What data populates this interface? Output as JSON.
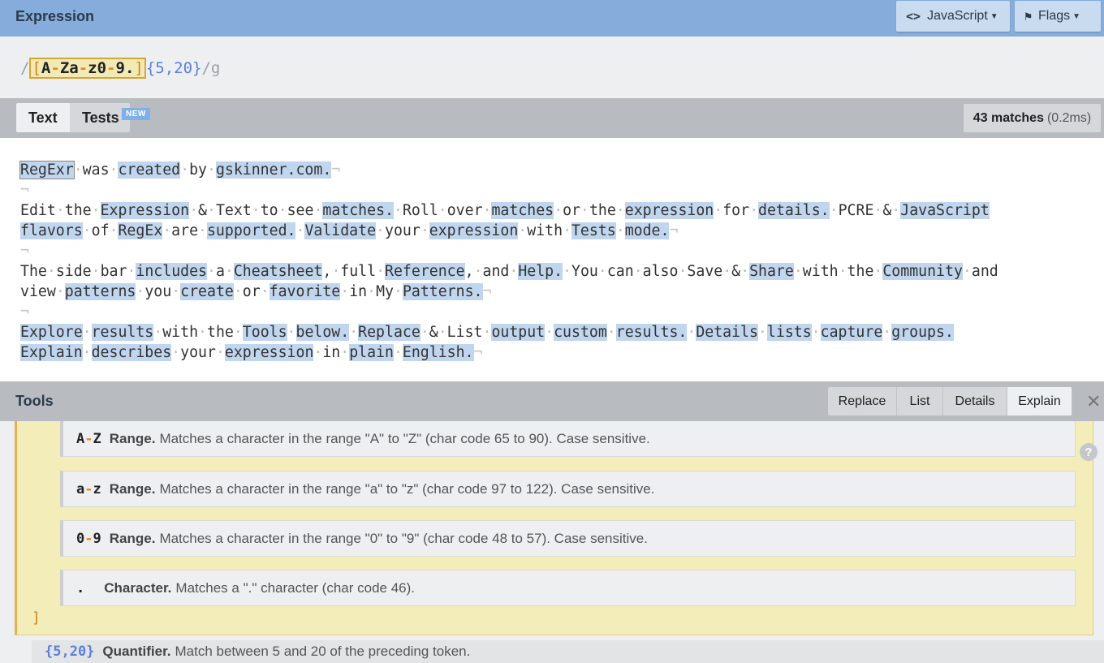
{
  "header": {
    "title": "Expression",
    "flavor_label": "JavaScript",
    "flags_label": "Flags"
  },
  "expression": {
    "open_slash": "/",
    "set_open": "[",
    "r1_from": "A",
    "r1_dash": "-",
    "r1_to": "Za",
    "r2_dash": "-",
    "r2_to": "z0",
    "r3_dash": "-",
    "r3_to": "9.",
    "set_close": "]",
    "quantifier": "{5,20}",
    "close_and_flags": "/g"
  },
  "text_bar": {
    "tab_text": "Text",
    "tab_tests": "Tests",
    "new_badge": "NEW",
    "match_count": "43 matches",
    "match_time": "(0.2ms)"
  },
  "tools": {
    "title": "Tools",
    "replace": "Replace",
    "list": "List",
    "details": "Details",
    "explain": "Explain",
    "close": "✕"
  },
  "explain": {
    "items": [
      {
        "tok_a": "A",
        "tok_dash": "-",
        "tok_b": "Z",
        "title": "Range.",
        "desc": "Matches a character in the range \"A\" to \"Z\" (char code 65 to 90). Case sensitive."
      },
      {
        "tok_a": "a",
        "tok_dash": "-",
        "tok_b": "z",
        "title": "Range.",
        "desc": "Matches a character in the range \"a\" to \"z\" (char code 97 to 122). Case sensitive."
      },
      {
        "tok_a": "0",
        "tok_dash": "-",
        "tok_b": "9",
        "title": "Range.",
        "desc": "Matches a character in the range \"0\" to \"9\" (char code 48 to 57). Case sensitive."
      },
      {
        "tok_a": ".",
        "tok_dash": "",
        "tok_b": "",
        "title": "Character.",
        "desc": "Matches a \".\" character (char code 46)."
      }
    ],
    "close_bracket": "]",
    "help": "?",
    "quantifier": {
      "tok": "{5,20}",
      "title": "Quantifier.",
      "desc": "Match between 5 and 20 of the preceding token."
    }
  },
  "text_lines": [
    "RegExr was created by gskinner.com.",
    "",
    "Edit the Expression & Text to see matches. Roll over matches or the expression for details. PCRE & JavaScript",
    "flavors of RegEx are supported. Validate your expression with Tests mode.",
    "",
    "The side bar includes a Cheatsheet, full Reference, and Help. You can also Save & Share with the Community and",
    "view patterns you create or favorite in My Patterns.",
    "",
    "Explore results with the Tools below. Replace & List output custom results. Details lists capture groups.",
    "Explain describes your expression in plain English."
  ],
  "text_eol": [
    true,
    true,
    false,
    true,
    true,
    false,
    true,
    true,
    false,
    true
  ]
}
